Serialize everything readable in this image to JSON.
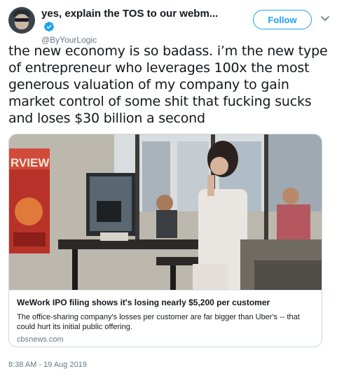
{
  "user": {
    "display_name": "yes, explain the TOS to our webm...",
    "handle": "@ByYourLogic",
    "verified": true
  },
  "actions": {
    "follow_label": "Follow"
  },
  "tweet": {
    "text": "the new economy is so badass. i’m the new type of entrepreneur who leverages 100x the most generous valuation of my company to gain market control of some shit that fucking sucks and loses $30 billion a second",
    "timestamp": "8:38 AM - 19 Aug 2019"
  },
  "card": {
    "title": "WeWork IPO filing shows it's losing nearly $5,200 per customer",
    "description": "The office-sharing company's losses per customer are far bigger than Uber's -- that could hurt its initial public offering.",
    "domain": "cbsnews.com",
    "image_poster_text": "RVIEW"
  },
  "colors": {
    "accent": "#1da1f2",
    "text": "#14171a",
    "muted": "#657786",
    "border": "#ccd6dd"
  },
  "icons": {
    "verified": "verified-badge-icon",
    "menu": "chevron-down-icon"
  }
}
